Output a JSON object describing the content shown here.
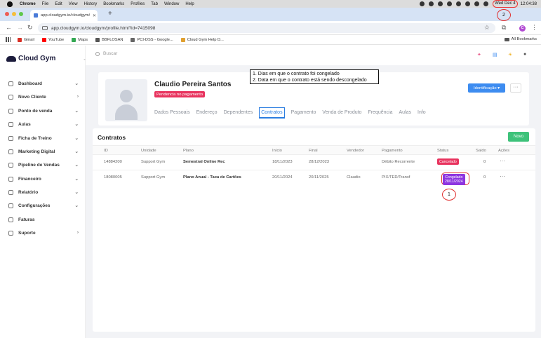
{
  "mac_menubar": {
    "app": "Chrome",
    "menus": [
      "File",
      "Edit",
      "View",
      "History",
      "Bookmarks",
      "Profiles",
      "Tab",
      "Window",
      "Help"
    ],
    "date": "Wed Dec 4",
    "time": "12:04:38"
  },
  "browser": {
    "tab_title": "app.cloudgym.io/cloudgym/p",
    "url": "app.cloudgym.io/cloudgym/profile.html?id=7415098",
    "profile_initial": "C",
    "bookmarks": [
      {
        "label": "Gmail",
        "color": "#d93025"
      },
      {
        "label": "YouTube",
        "color": "#ff0000"
      },
      {
        "label": "Maps",
        "color": "#34a853"
      },
      {
        "label": "BBFLOSAN",
        "color": "#555555"
      },
      {
        "label": "PCI-DSS - Google...",
        "color": "#666666"
      },
      {
        "label": "Cloud Gym Help D...",
        "color": "#e0a030"
      }
    ],
    "all_bookmarks": "All Bookmarks"
  },
  "app": {
    "logo": "Cloud Gym",
    "search_placeholder": "Buscar",
    "sidebar": [
      {
        "label": "Dashboard",
        "chevron": "⌄"
      },
      {
        "label": "Novo Cliente",
        "chevron": "›"
      },
      {
        "label": "Ponto de venda",
        "chevron": "⌄"
      },
      {
        "label": "Aulas",
        "chevron": "⌄"
      },
      {
        "label": "Ficha de Treino",
        "chevron": "⌄"
      },
      {
        "label": "Marketing Digital",
        "chevron": "⌄"
      },
      {
        "label": "Pipeline de Vendas",
        "chevron": "⌄"
      },
      {
        "label": "Financeiro",
        "chevron": "⌄"
      },
      {
        "label": "Relatório",
        "chevron": "⌄"
      },
      {
        "label": "Configurações",
        "chevron": "⌄"
      },
      {
        "label": "Faturas",
        "chevron": ""
      },
      {
        "label": "Suporte",
        "chevron": "›"
      }
    ]
  },
  "profile": {
    "name": "Claudio Pereira Santos",
    "pending_badge": "Pendencia no pagamento",
    "tabs": [
      "Dados Pessoais",
      "Endereço",
      "Dependentes",
      "Contratos",
      "Pagamento",
      "Venda de Produto",
      "Frequência",
      "Aulas",
      "Info"
    ],
    "active_tab": "Contratos",
    "id_button": "Identificação ▾",
    "more_button": "···"
  },
  "contracts": {
    "title": "Contratos",
    "new_button": "Novo",
    "columns": [
      "ID",
      "Unidade",
      "Plano",
      "Início",
      "Final",
      "Vendedor",
      "Pagamento",
      "Status",
      "Saldo",
      "Ações"
    ],
    "rows": [
      {
        "id": "14884200",
        "unit": "Support Gym",
        "plan": "Semestral Online Rec",
        "start": "18/11/2023",
        "end": "28/12/2023",
        "seller": "",
        "payment": "Débito Recorrente",
        "status": "Cancelado",
        "balance": "0",
        "actions": "···"
      },
      {
        "id": "18080005",
        "unit": "Support Gym",
        "plan": "Plano Anual - Taxa de Cartões",
        "start": "20/11/2024",
        "end": "20/11/2025",
        "seller": "Claudio",
        "payment": "PIX/TED/Transf",
        "status_line1": "Congelado",
        "status_line2": "28/11/2024",
        "balance": "0",
        "actions": "···"
      }
    ]
  },
  "annotations": {
    "note_line1": "1. Dias em que o contrato foi congelado",
    "note_line2": "2. Data em que o contrato está sendo descongelado",
    "marker1": "1",
    "marker2": "2"
  }
}
